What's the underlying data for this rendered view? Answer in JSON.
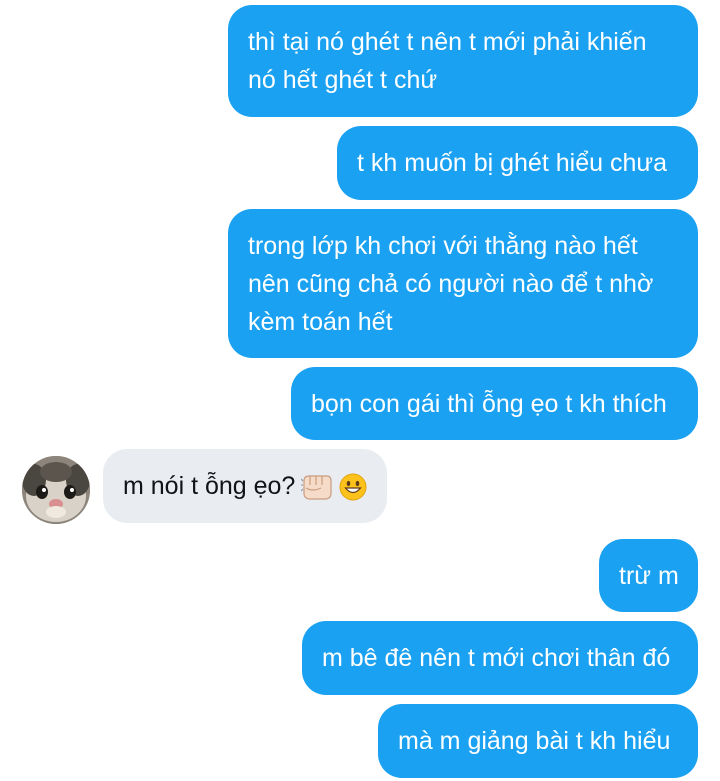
{
  "contact": {
    "avatar_icon": "cat-avatar-icon"
  },
  "messages": [
    {
      "sender": "me",
      "lines": [
        "thì tại nó ghét t nên t mới phải khiến",
        "nó hết ghét t chứ"
      ]
    },
    {
      "sender": "me",
      "lines": [
        "t kh muốn bị ghét hiểu chưa"
      ]
    },
    {
      "sender": "me",
      "lines": [
        "trong lớp kh chơi với thằng nào hết",
        "nên cũng chả có người nào để t nhờ",
        "kèm toán hết"
      ]
    },
    {
      "sender": "me",
      "lines": [
        "bọn con gái thì ỗng ẹo t kh thích"
      ]
    },
    {
      "sender": "them",
      "lines": [
        "m nói t ỗng ẹo?"
      ],
      "emojis": [
        "fist-bump-icon",
        "grinning-face-icon"
      ]
    },
    {
      "sender": "me",
      "lines": [
        "trừ m"
      ]
    },
    {
      "sender": "me",
      "lines": [
        "m bê đê nên t mới chơi thân đó"
      ]
    },
    {
      "sender": "me",
      "lines": [
        "mà m giảng bài t kh hiểu"
      ]
    }
  ],
  "colors": {
    "outgoing_bubble": "#1aa1f2",
    "incoming_bubble": "#e9edf1",
    "outgoing_text": "#ffffff",
    "incoming_text": "#101418"
  }
}
